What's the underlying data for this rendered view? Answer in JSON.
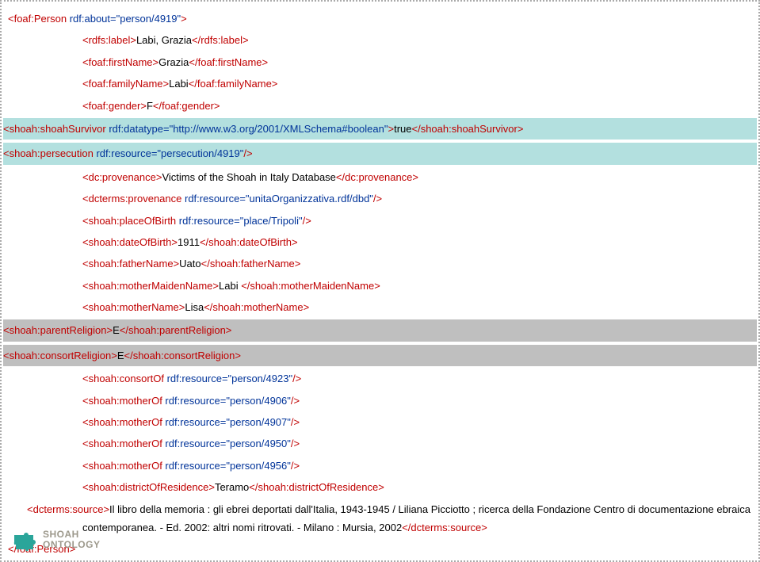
{
  "lines": [
    {
      "indent": "indent1",
      "segments": [
        {
          "t": "<foaf:Person ",
          "c": "red"
        },
        {
          "t": "rdf:about=\"person/4919\"",
          "c": "blue"
        },
        {
          "t": ">",
          "c": "red"
        }
      ]
    },
    {
      "indent": "indent2",
      "segments": [
        {
          "t": "<rdfs:label>",
          "c": "red"
        },
        {
          "t": "Labi, Grazia",
          "c": "black"
        },
        {
          "t": "</rdfs:label>",
          "c": "red"
        }
      ]
    },
    {
      "indent": "indent2",
      "segments": [
        {
          "t": "<foaf:firstName>",
          "c": "red"
        },
        {
          "t": "Grazia",
          "c": "black"
        },
        {
          "t": "</foaf:firstName>",
          "c": "red"
        }
      ]
    },
    {
      "indent": "indent2",
      "segments": [
        {
          "t": "<foaf:familyName>",
          "c": "red"
        },
        {
          "t": "Labi",
          "c": "black"
        },
        {
          "t": "</foaf:familyName>",
          "c": "red"
        }
      ]
    },
    {
      "indent": "indent2",
      "segments": [
        {
          "t": "<foaf:gender>",
          "c": "red"
        },
        {
          "t": "F",
          "c": "black"
        },
        {
          "t": "</foaf:gender>",
          "c": "red"
        }
      ]
    },
    {
      "indent": "indent2",
      "hl": "green",
      "segments": [
        {
          "t": "<shoah:shoahSurvivor ",
          "c": "red"
        },
        {
          "t": "rdf:datatype=\"http://www.w3.org/2001/XMLSchema#boolean\"",
          "c": "blue"
        },
        {
          "t": ">",
          "c": "red"
        },
        {
          "t": "true",
          "c": "black"
        },
        {
          "t": "</shoah:shoahSurvivor>",
          "c": "red"
        }
      ]
    },
    {
      "indent": "indent2",
      "hl": "green",
      "segments": [
        {
          "t": "<shoah:persecution ",
          "c": "red"
        },
        {
          "t": "rdf:resource=\"persecution/4919\"",
          "c": "blue"
        },
        {
          "t": "/>",
          "c": "red"
        }
      ]
    },
    {
      "indent": "indent2",
      "segments": [
        {
          "t": "<dc:provenance>",
          "c": "red"
        },
        {
          "t": "Victims of the Shoah in Italy Database",
          "c": "black"
        },
        {
          "t": "</dc:provenance>",
          "c": "red"
        }
      ]
    },
    {
      "indent": "indent2",
      "segments": [
        {
          "t": "<dcterms:provenance ",
          "c": "red"
        },
        {
          "t": "rdf:resource=\"unitaOrganizzativa.rdf/dbd\"",
          "c": "blue"
        },
        {
          "t": "/>",
          "c": "red"
        }
      ]
    },
    {
      "indent": "indent2",
      "segments": [
        {
          "t": "<shoah:placeOfBirth ",
          "c": "red"
        },
        {
          "t": "rdf:resource=\"place/Tripoli\"",
          "c": "blue"
        },
        {
          "t": "/>",
          "c": "red"
        }
      ]
    },
    {
      "indent": "indent2",
      "segments": [
        {
          "t": "<shoah:dateOfBirth>",
          "c": "red"
        },
        {
          "t": "1911",
          "c": "black"
        },
        {
          "t": "</shoah:dateOfBirth>",
          "c": "red"
        }
      ]
    },
    {
      "indent": "indent2",
      "segments": [
        {
          "t": "<shoah:fatherName>",
          "c": "red"
        },
        {
          "t": "Uato",
          "c": "black"
        },
        {
          "t": "</shoah:fatherName>",
          "c": "red"
        }
      ]
    },
    {
      "indent": "indent2",
      "segments": [
        {
          "t": "<shoah:motherMaidenName>",
          "c": "red"
        },
        {
          "t": "Labi ",
          "c": "black"
        },
        {
          "t": "</shoah:motherMaidenName>",
          "c": "red"
        }
      ]
    },
    {
      "indent": "indent2",
      "segments": [
        {
          "t": "<shoah:motherName>",
          "c": "red"
        },
        {
          "t": "Lisa",
          "c": "black"
        },
        {
          "t": "</shoah:motherName>",
          "c": "red"
        }
      ]
    },
    {
      "indent": "indent2",
      "hl": "gray",
      "segments": [
        {
          "t": "<shoah:parentReligion>",
          "c": "red"
        },
        {
          "t": "E",
          "c": "black"
        },
        {
          "t": "</shoah:parentReligion>",
          "c": "red"
        }
      ]
    },
    {
      "indent": "indent2",
      "hl": "gray",
      "segments": [
        {
          "t": "<shoah:consortReligion>",
          "c": "red"
        },
        {
          "t": "E",
          "c": "black"
        },
        {
          "t": "</shoah:consortReligion>",
          "c": "red"
        }
      ]
    },
    {
      "indent": "indent2",
      "segments": [
        {
          "t": "<shoah:consortOf ",
          "c": "red"
        },
        {
          "t": "rdf:resource=\"person/4923\"",
          "c": "blue"
        },
        {
          "t": "/>",
          "c": "red"
        }
      ]
    },
    {
      "indent": "indent2",
      "segments": [
        {
          "t": "<shoah:motherOf ",
          "c": "red"
        },
        {
          "t": "rdf:resource=\"person/4906\"",
          "c": "blue"
        },
        {
          "t": "/>",
          "c": "red"
        }
      ]
    },
    {
      "indent": "indent2",
      "segments": [
        {
          "t": "<shoah:motherOf ",
          "c": "red"
        },
        {
          "t": "rdf:resource=\"person/4907\"",
          "c": "blue"
        },
        {
          "t": "/>",
          "c": "red"
        }
      ]
    },
    {
      "indent": "indent2",
      "segments": [
        {
          "t": "<shoah:motherOf ",
          "c": "red"
        },
        {
          "t": "rdf:resource=\"person/4950\"",
          "c": "blue"
        },
        {
          "t": "/>",
          "c": "red"
        }
      ]
    },
    {
      "indent": "indent2",
      "segments": [
        {
          "t": "<shoah:motherOf ",
          "c": "red"
        },
        {
          "t": "rdf:resource=\"person/4956\"",
          "c": "blue"
        },
        {
          "t": "/>",
          "c": "red"
        }
      ]
    },
    {
      "indent": "indent2",
      "segments": [
        {
          "t": "<shoah:districtOfResidence>",
          "c": "red"
        },
        {
          "t": "Teramo",
          "c": "black"
        },
        {
          "t": "</shoah:districtOfResidence>",
          "c": "red"
        }
      ]
    }
  ],
  "source_open": "<dcterms:source>",
  "source_text": "Il libro della memoria : gli ebrei deportati dall'Italia, 1943-1945 / Liliana Picciotto ; ricerca della Fondazione Centro di documentazione ebraica contemporanea. - Ed. 2002: altri nomi ritrovati. - Milano : Mursia, 2002",
  "source_close": "</dcterms:source>",
  "closing": "</foaf:Person>",
  "footer1": "SHOAH",
  "footer2": "ONTOLOGY"
}
